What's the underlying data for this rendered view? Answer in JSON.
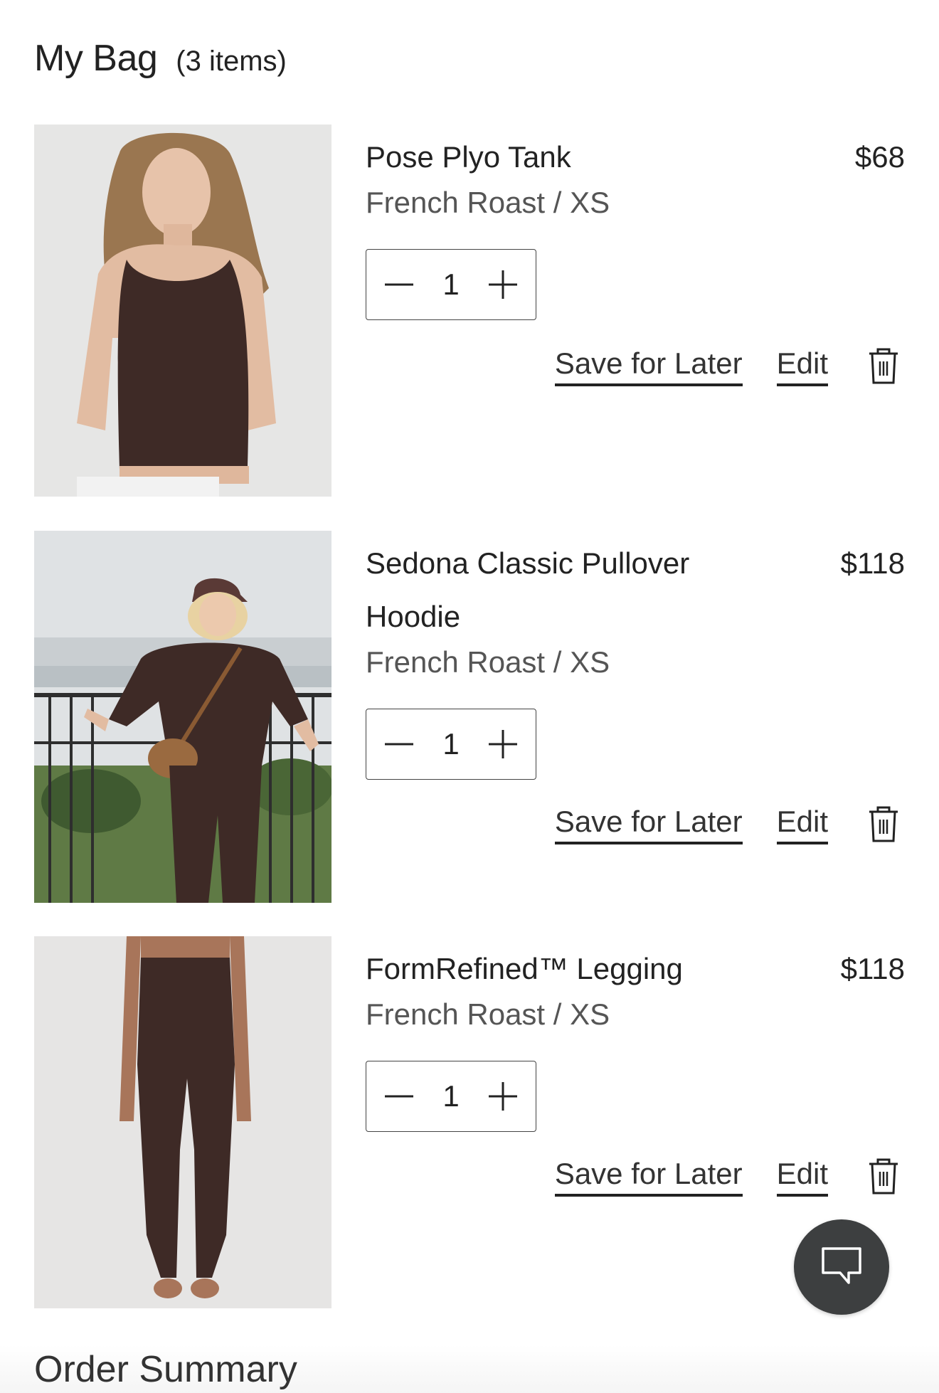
{
  "header": {
    "title": "My Bag",
    "count": "(3 items)"
  },
  "items": [
    {
      "name": "Pose Plyo Tank",
      "price": "$68",
      "variant": "French Roast / XS",
      "quantity": "1",
      "save_label": "Save for Later",
      "edit_label": "Edit"
    },
    {
      "name": "Sedona Classic Pullover Hoodie",
      "price": "$118",
      "variant": "French Roast / XS",
      "quantity": "1",
      "save_label": "Save for Later",
      "edit_label": "Edit"
    },
    {
      "name": "FormRefined™ Legging",
      "price": "$118",
      "variant": "French Roast / XS",
      "quantity": "1",
      "save_label": "Save for Later",
      "edit_label": "Edit"
    }
  ],
  "order_summary": {
    "title": "Order Summary"
  },
  "colors": {
    "product": "#3e2a26",
    "chat_button": "#3d3f40"
  },
  "icons": {
    "decrement": "minus-icon",
    "increment": "plus-icon",
    "remove": "trash-icon",
    "chat": "chat-bubble-icon"
  }
}
